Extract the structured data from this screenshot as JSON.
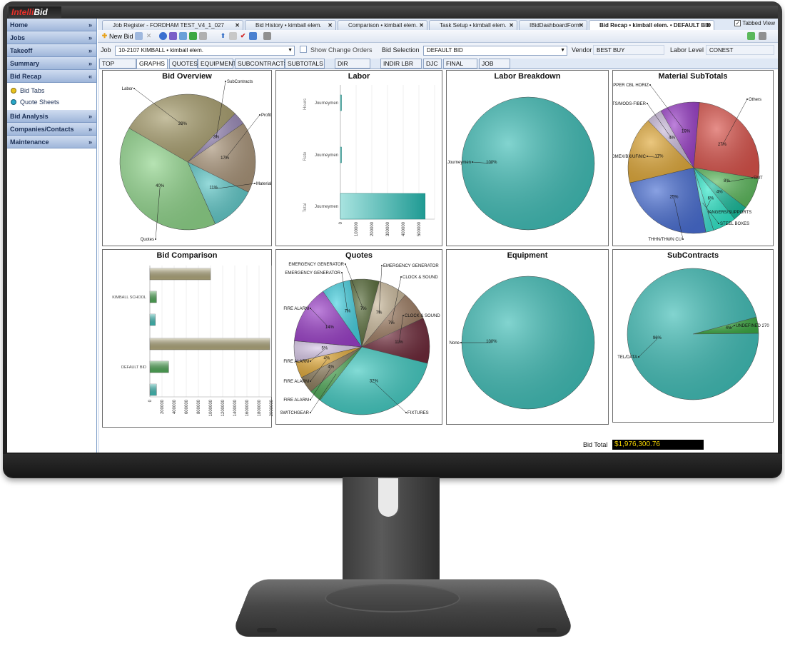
{
  "app": {
    "logo_part1": "Intelli",
    "logo_part2": "Bid"
  },
  "sidebar": {
    "sections": [
      {
        "label": "Home"
      },
      {
        "label": "Jobs"
      },
      {
        "label": "Takeoff"
      },
      {
        "label": "Summary"
      },
      {
        "label": "Bid Recap"
      }
    ],
    "bid_recap_items": [
      {
        "label": "Bid Tabs",
        "color": "#e8c21c"
      },
      {
        "label": "Quote Sheets",
        "color": "#2aa7c7"
      }
    ],
    "lower_sections": [
      {
        "label": "Bid Analysis"
      },
      {
        "label": "Companies/Contacts"
      },
      {
        "label": "Maintenance"
      }
    ]
  },
  "doc_tabs": [
    {
      "label": "Job Register - FORDHAM TEST_V4_1_027"
    },
    {
      "label": "Bid History • kimball elem."
    },
    {
      "label": "Comparison • kimball elem."
    },
    {
      "label": "Task Setup • kimball elem."
    },
    {
      "label": "IBidDashboardForm"
    },
    {
      "label": "Bid Recap • kimball elem. • DEFAULT BID"
    }
  ],
  "tabbed_view": {
    "label": "Tabbed View",
    "checked": true,
    "check": "✓"
  },
  "toolbar": {
    "new_bid": "New Bid"
  },
  "job_row": {
    "job_label": "Job",
    "job_value": "10-2107 KIMBALL • kimball elem.",
    "show_change_orders": "Show Change Orders",
    "bid_selection_label": "Bid Selection",
    "bid_selection_value": "DEFAULT BID",
    "vendor_label": "Vendor",
    "vendor_value": "BEST BUY",
    "labor_level_label": "Labor Level",
    "labor_level_value": "CONEST"
  },
  "sub_tabs": [
    "TOP SHEET",
    "GRAPHS",
    "QUOTES",
    "EQUIPMENT",
    "SUBCONTRACTS",
    "SUBTOTALS",
    "DIR LABOR",
    "INDIR LBR",
    "DJC",
    "FINAL PRICE",
    "JOB INFO"
  ],
  "bid_total": {
    "label": "Bid Total",
    "value": "$1,976,300.76"
  },
  "chart_data": [
    {
      "type": "pie",
      "title": "Bid Overview",
      "slices": [
        {
          "label": "Labor",
          "value": 29,
          "pct_label": "29%",
          "color": "#a89e6e"
        },
        {
          "label": "SubContracts",
          "value": 3,
          "pct_label": "3%",
          "color": "#9a8ab8"
        },
        {
          "label": "Profit",
          "value": 17,
          "pct_label": "17%",
          "color": "#a99479"
        },
        {
          "label": "Material",
          "value": 11,
          "pct_label": "11%",
          "color": "#5ec7c7"
        },
        {
          "label": "Quotes",
          "value": 40,
          "pct_label": "40%",
          "color": "#8fd48a"
        }
      ]
    },
    {
      "type": "bar",
      "title": "Labor",
      "orientation": "horizontal",
      "groups": [
        "Hours",
        "Rate",
        "Total"
      ],
      "categories": [
        "Journeymen",
        "Journeymen",
        "Journeymen"
      ],
      "values": [
        2000,
        50,
        540000
      ],
      "xlim": [
        0,
        600000
      ],
      "x_ticks": [
        "0",
        "100000",
        "200000",
        "300000",
        "400000",
        "500000"
      ]
    },
    {
      "type": "pie",
      "title": "Labor Breakdown",
      "slices": [
        {
          "label": "Journeymen",
          "value": 100,
          "pct_label": "100%",
          "color": "#3fbdb6"
        }
      ]
    },
    {
      "type": "pie",
      "title": "Material SubTotals",
      "slices": [
        {
          "label": "Others",
          "value": 27,
          "pct_label": "27%",
          "color": "#d9534b"
        },
        {
          "label": "EMT",
          "value": 8,
          "pct_label": "8%",
          "color": "#5cb85c"
        },
        {
          "label": "",
          "value": 4,
          "pct_label": "4%",
          "color": "#1abc9c"
        },
        {
          "label": "HANGERS/SUPPORTS",
          "value": 6,
          "pct_label": "6%",
          "color": "#2ee6c8"
        },
        {
          "label": "STEEL BOXES",
          "value": 2,
          "pct_label": "",
          "color": "#40e0d0"
        },
        {
          "label": "THHN/THWN CU",
          "value": 25,
          "pct_label": "25%",
          "color": "#4a6fd3"
        },
        {
          "label": "ROMEX/BX/UF/MC",
          "value": 17,
          "pct_label": "17%",
          "color": "#e0a93a"
        },
        {
          "label": "OUTLETS/MODS-FIBER",
          "value": 4,
          "pct_label": "4%",
          "color": "#c8b8d8"
        },
        {
          "label": "COPPER CBL HORIZ",
          "value": 10,
          "pct_label": "10%",
          "color": "#9b40c8"
        }
      ]
    },
    {
      "type": "bar",
      "title": "Bid Comparison",
      "orientation": "horizontal",
      "categories": [
        "KIMBALL SCHOOL",
        "DEFAULT BID"
      ],
      "series": [
        {
          "values": [
            1000000,
            1976300
          ],
          "color": "#b0a77a"
        },
        {
          "values": [
            110000,
            310000
          ],
          "color": "#4fa857"
        },
        {
          "values": [
            90000,
            110000
          ],
          "color": "#3fbdb6"
        }
      ],
      "xlim": [
        0,
        2000000
      ],
      "x_ticks": [
        "0",
        "200000",
        "400000",
        "600000",
        "800000",
        "1000000",
        "1200000",
        "1400000",
        "1600000",
        "1800000",
        "2000000"
      ]
    },
    {
      "type": "pie",
      "title": "Quotes",
      "slices": [
        {
          "label": "EMERGENCY GENERATOR",
          "value": 7,
          "pct_label": "7%",
          "color": "#5a6e3c"
        },
        {
          "label": "EMERGENCY GENERATOR",
          "value": 7,
          "pct_label": "7%",
          "color": "#c9b89a"
        },
        {
          "label": "CLOCK & SOUND",
          "value": 7,
          "pct_label": "7%",
          "color": "#9b7a60"
        },
        {
          "label": "CLOCK & SOUND",
          "value": 11,
          "pct_label": "11%",
          "color": "#6e2a3a"
        },
        {
          "label": "FIXTURES",
          "value": 32,
          "pct_label": "32%",
          "color": "#40c9c0"
        },
        {
          "label": "SWITCHGEAR",
          "value": 3,
          "pct_label": "",
          "color": "#4fa857"
        },
        {
          "label": "FIRE ALARM",
          "value": 4,
          "pct_label": "4%",
          "color": "#8a7a5a"
        },
        {
          "label": "FIRE ALARM",
          "value": 4,
          "pct_label": "4%",
          "color": "#e0a93a"
        },
        {
          "label": "FIRE ALARM",
          "value": 5,
          "pct_label": "5%",
          "color": "#d8c8e8"
        },
        {
          "label": "FIRE ALARM",
          "value": 14,
          "pct_label": "14%",
          "color": "#9b40c8"
        },
        {
          "label": "EMERGENCY GENERATOR",
          "value": 7,
          "pct_label": "7%",
          "color": "#45d0e0"
        }
      ]
    },
    {
      "type": "pie",
      "title": "Equipment",
      "slices": [
        {
          "label": "None",
          "value": 100,
          "pct_label": "100%",
          "color": "#3fbdb6"
        }
      ]
    },
    {
      "type": "pie",
      "title": "SubContracts",
      "slices": [
        {
          "label": "UNDEFINED 270",
          "value": 4,
          "pct_label": "4%",
          "color": "#3da843"
        },
        {
          "label": "TEL/DATA",
          "value": 96,
          "pct_label": "96%",
          "color": "#3fbdb6"
        }
      ]
    }
  ]
}
